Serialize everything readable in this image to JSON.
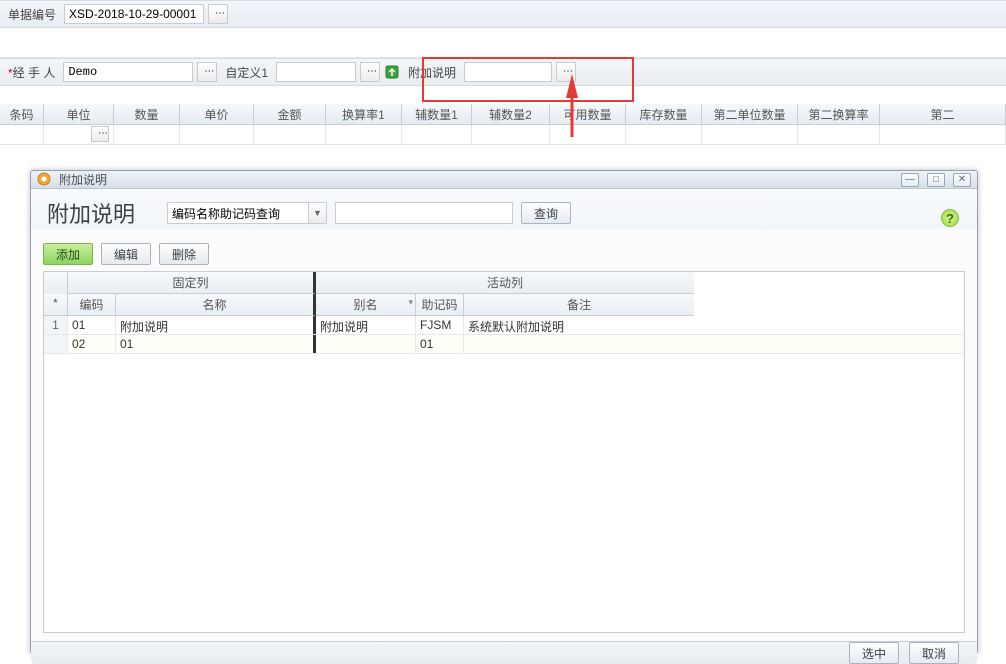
{
  "topForm": {
    "docNoLabel": "单据编号",
    "docNoValue": "XSD-2018-10-29-00001",
    "handlerLabel": "经 手 人",
    "handlerValue": "Demo",
    "custom1Label": "自定义1",
    "attachLabel": "附加说明"
  },
  "gridHeaders": [
    "条码",
    "单位",
    "数量",
    "单价",
    "金额",
    "换算率1",
    "辅数量1",
    "辅数量2",
    "可用数量",
    "库存数量",
    "第二单位数量",
    "第二换算率",
    "第二"
  ],
  "dialog": {
    "winTitle": "附加说明",
    "heading": "附加说明",
    "searchComboValue": "编码名称助记码查询",
    "queryBtn": "查询",
    "addBtn": "添加",
    "editBtn": "编辑",
    "deleteBtn": "删除",
    "groupFixed": "固定列",
    "groupActive": "活动列",
    "starHeader": "*",
    "headers": {
      "code": "编码",
      "name": "名称",
      "alias": "别名",
      "mnem": "助记码",
      "remark": "备注"
    },
    "rows": [
      {
        "num": "1",
        "code": "01",
        "name": "附加说明",
        "alias": "附加说明",
        "mnem": "FJSM",
        "remark": "系统默认附加说明"
      },
      {
        "num": "",
        "code": "02",
        "name": "01",
        "alias": "",
        "mnem": "01",
        "remark": ""
      }
    ],
    "selectBtn": "选中",
    "cancelBtn": "取消"
  }
}
